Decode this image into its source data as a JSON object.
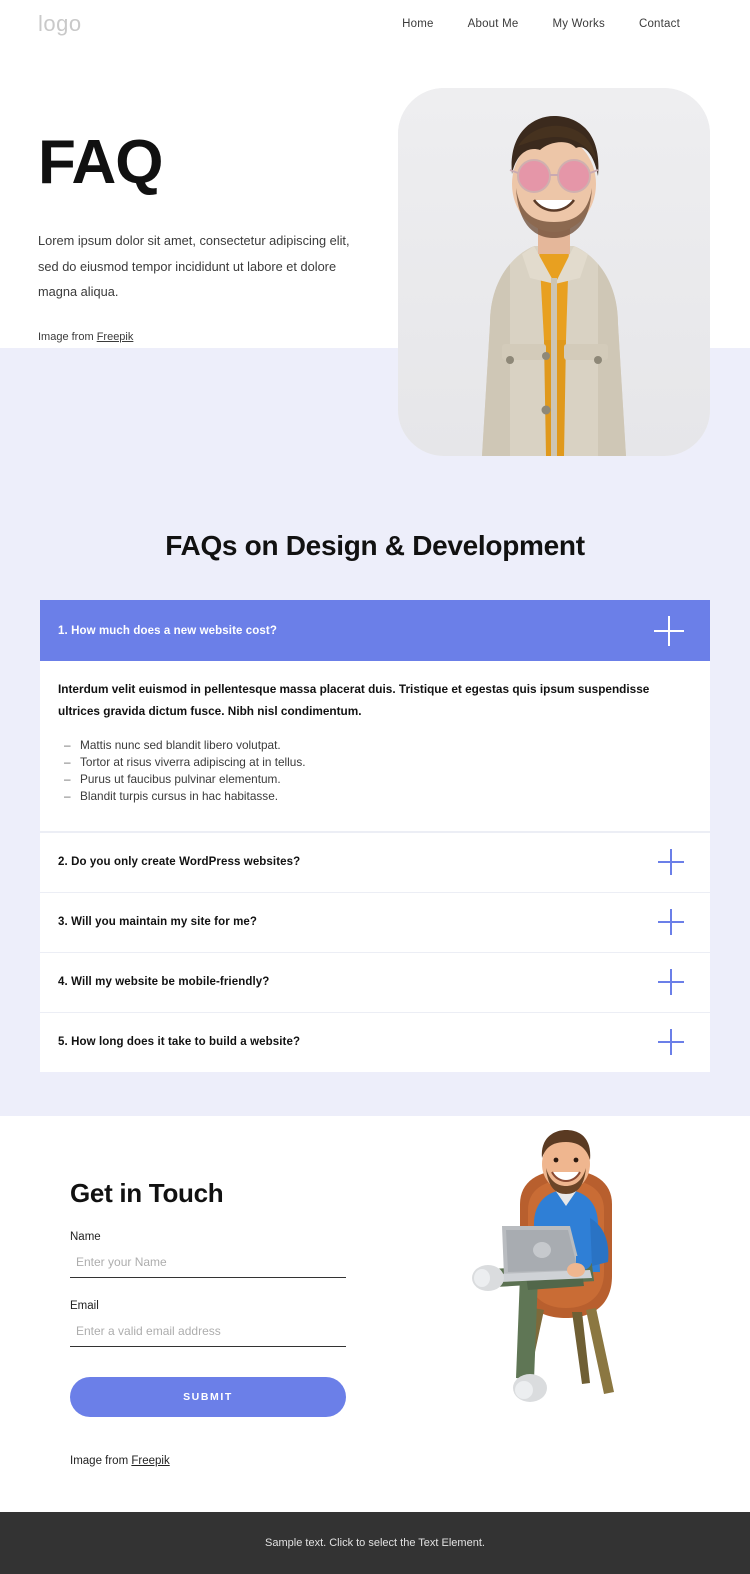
{
  "header": {
    "logo": "logo",
    "nav": [
      {
        "label": "Home"
      },
      {
        "label": "About Me"
      },
      {
        "label": "My Works"
      },
      {
        "label": "Contact"
      }
    ]
  },
  "hero": {
    "title": "FAQ",
    "paragraph": "Lorem ipsum dolor sit amet, consectetur adipiscing elit, sed do eiusmod tempor incididunt ut labore et dolore magna aliqua.",
    "credit_prefix": "Image from ",
    "credit_link": "Freepik",
    "photo_alt": "smiling-man-in-beige-denim-jacket-and-pink-sunglasses"
  },
  "faq": {
    "heading": "FAQs on Design & Development",
    "items": [
      {
        "question": "1. How much does a new website cost?",
        "expanded": true,
        "lead": "Interdum velit euismod in pellentesque massa placerat duis. Tristique et egestas quis ipsum suspendisse ultrices gravida dictum fusce. Nibh nisl condimentum.",
        "bullets": [
          "Mattis nunc sed blandit libero volutpat.",
          "Tortor at risus viverra adipiscing at in tellus.",
          "Purus ut faucibus pulvinar elementum.",
          "Blandit turpis cursus in hac habitasse."
        ]
      },
      {
        "question": "2. Do you only create WordPress websites?",
        "expanded": false
      },
      {
        "question": "3. Will you maintain my site for me?",
        "expanded": false
      },
      {
        "question": "4. Will my website be mobile-friendly?",
        "expanded": false
      },
      {
        "question": "5. How long does it take to build a website?",
        "expanded": false
      }
    ]
  },
  "contact": {
    "title": "Get in Touch",
    "name_label": "Name",
    "name_placeholder": "Enter your Name",
    "name_value": "",
    "email_label": "Email",
    "email_placeholder": "Enter a valid email address",
    "email_value": "",
    "submit_label": "SUBMIT",
    "credit_prefix": "Image from ",
    "credit_link": "Freepik",
    "illustration_alt": "3d-character-sitting-in-orange-chair-with-laptop"
  },
  "footer": {
    "text": "Sample text. Click to select the Text Element."
  },
  "colors": {
    "accent": "#6b7fe8",
    "section_bg": "#edeefa",
    "footer_bg": "#333333"
  }
}
